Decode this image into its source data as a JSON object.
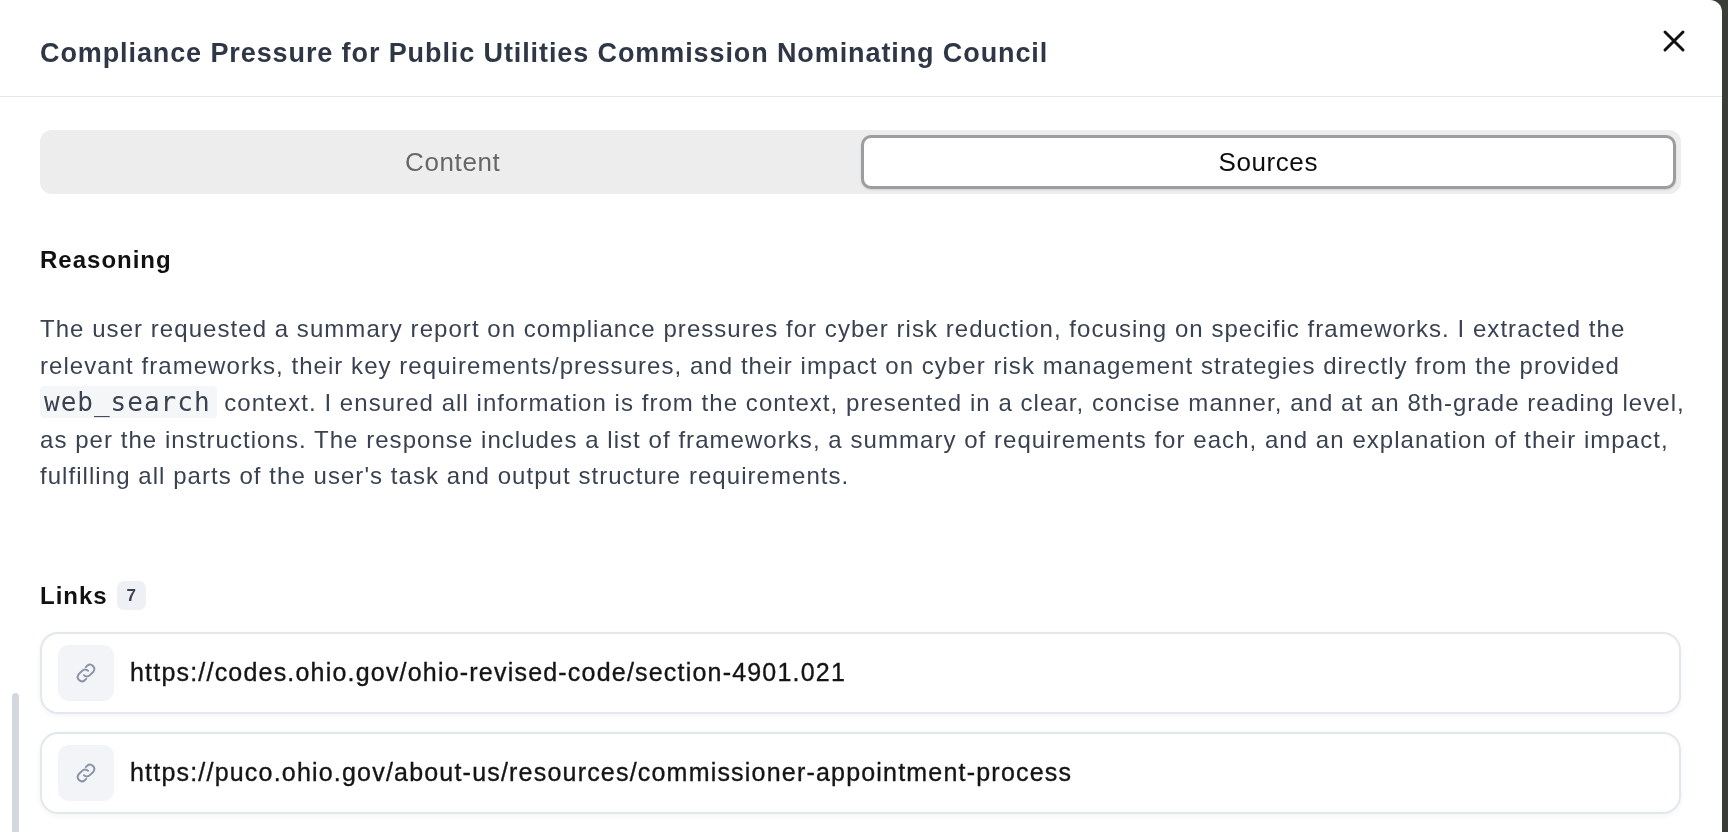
{
  "dialog": {
    "title": "Compliance Pressure for Public Utilities Commission Nominating Council"
  },
  "tabs": [
    {
      "label": "Content",
      "selected": false
    },
    {
      "label": "Sources",
      "selected": true
    }
  ],
  "reasoning": {
    "heading": "Reasoning",
    "paragraph": [
      {
        "kind": "text",
        "text": "The user requested a summary report on compliance pressures for cyber risk reduction, focusing on specific frameworks. I extracted the relevant frameworks, their key requirements/pressures, and their impact on cyber risk management strategies directly from the provided "
      },
      {
        "kind": "code",
        "text": "web_search"
      },
      {
        "kind": "text",
        "text": " context. I ensured all information is from the context, presented in a clear, concise manner, and at an 8th-grade reading level, as per the instructions. The response includes a list of frameworks, a summary of requirements for each, and an explanation of their impact, fulfilling all parts of the user's task and output structure requirements."
      }
    ]
  },
  "links": {
    "heading": "Links",
    "count": "7",
    "items": [
      {
        "url": "https://codes.ohio.gov/ohio-revised-code/section-4901.021"
      },
      {
        "url": "https://puco.ohio.gov/about-us/resources/commissioner-appointment-process"
      }
    ]
  }
}
